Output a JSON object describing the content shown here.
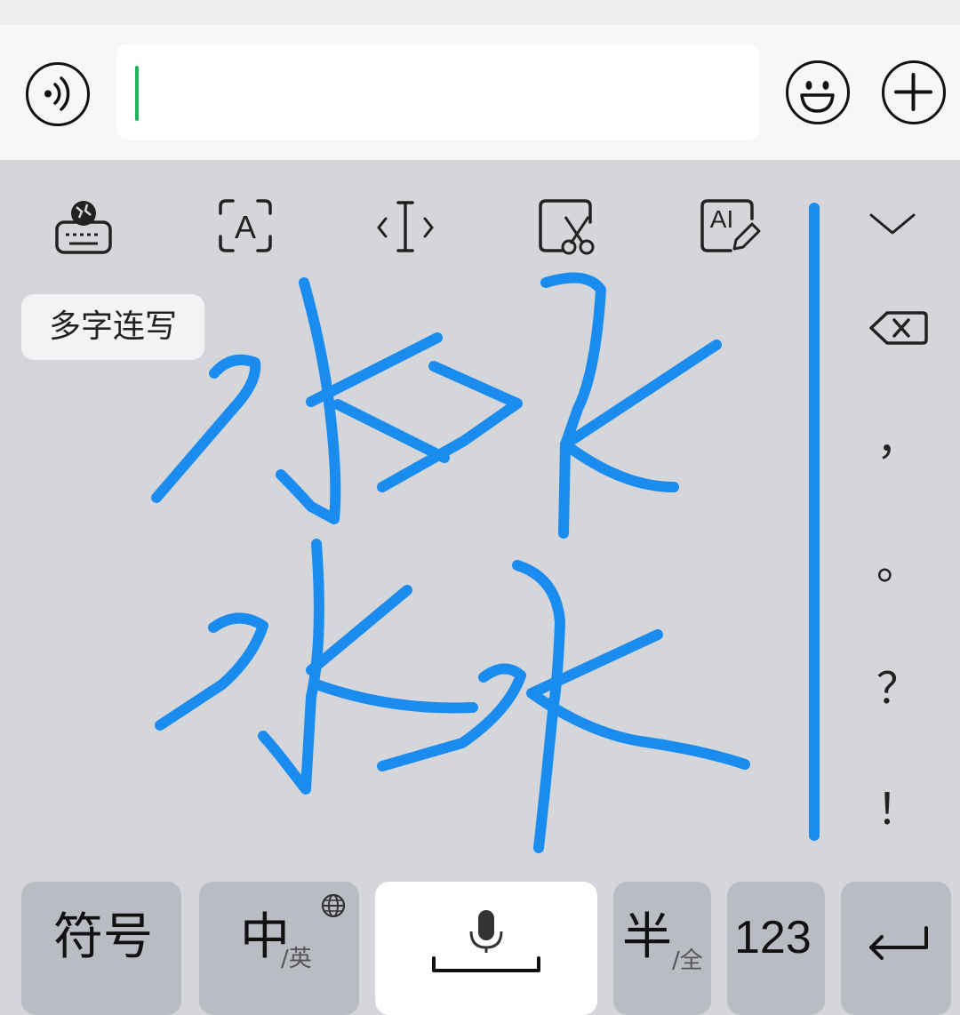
{
  "input_bar": {
    "voice_icon": "voice-wave-icon",
    "emoji_icon": "smiley-icon",
    "plus_icon": "plus-icon",
    "text_value": "",
    "caret_color": "#1fb55a"
  },
  "toolbar": {
    "items": [
      {
        "icon": "keyboard-globe-icon"
      },
      {
        "icon": "text-scan-icon"
      },
      {
        "icon": "cursor-move-icon"
      },
      {
        "icon": "clipboard-scissors-icon"
      },
      {
        "icon": "ai-write-icon"
      }
    ],
    "collapse_icon": "chevron-down-icon"
  },
  "handwriting": {
    "mode_label": "多字连写",
    "ink_color": "#1a8cf0"
  },
  "side_keys": {
    "backspace_icon": "backspace-icon",
    "comma": "，",
    "period": "。",
    "question": "？",
    "exclaim": "！"
  },
  "bottom_row": {
    "symbols": "符号",
    "lang_main": "中",
    "lang_sub": "/英",
    "space_icon": "microphone-icon",
    "width_main": "半",
    "width_sub": "/全",
    "numbers": "123",
    "enter_icon": "return-icon"
  }
}
